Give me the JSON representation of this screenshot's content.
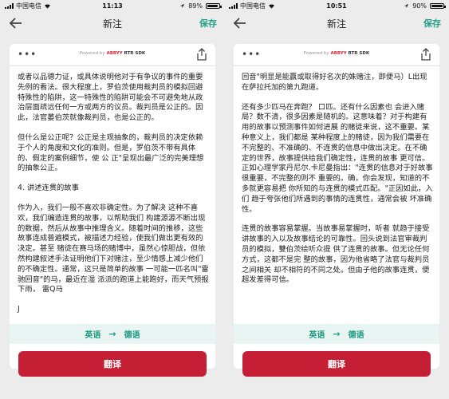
{
  "left": {
    "status": {
      "carrier": "中国电信",
      "time": "11:13",
      "battery_text": "89%",
      "battery_level": 0.89
    },
    "nav": {
      "title": "新注",
      "save": "保存"
    },
    "powered": {
      "prefix": "Powered by",
      "brand": "ABBYY",
      "suffix": "RTR SDK"
    },
    "text": {
      "p1": "或者以品德力证，或具体说明他对于有争议的事件的重要先例的看法。很大程度上，罗伯茨使用裁判员的模拟回避特殊性的陷阱，这一特殊性的陷阱可能会不可避免地从政治层面疏远任何一方或两方的议员。裁判员是公正的。因此，法官萎伯茨就像裁判员，也是公正的。",
      "p2": "但什么是公正呢？公正是主观抽象的，裁判员的决定依赖于个人的角度和文化的准则。但是，罗伯茨不带有具体的、假定的案例细节，使 公 正\"呈现出最广泛的完美理想的抽象公正。",
      "p3": "4. 讲述连贯的故事",
      "p4": "作为入，我们一般不喜欢非确定性。为了解决 这种不喜欢，我们编造连贯的故事，以帮助我们 构建源源不断出现的数据，然后从故事中推理含义。随着时间的推移，这些故事连成普遍模式，被描述力经验，使我们做出更有效的决定。甚至 赌徒在赛马场的赌博中，虽然心惊胆战，但依然构建叙述手法证明他们下对赌注，至少情感上减少他们的不确定性。通常，这只是简单的故事 一可能一匹名叫\"雷驰回音\"的马，最近在湿 派派的跑道上能跑好，而天气预报下雨， 雷Q马",
      "p5": "J"
    },
    "lang": {
      "from": "英语",
      "to": "德语"
    },
    "translate": "翻译"
  },
  "right": {
    "status": {
      "carrier": "中国电信",
      "time": "10:51",
      "battery_text": "90%",
      "battery_level": 0.9
    },
    "nav": {
      "title": "新注",
      "save": "保存"
    },
    "powered": {
      "prefix": "Powered by",
      "brand": "ABBYY",
      "suffix": "RTR SDK"
    },
    "text": {
      "p1": "回音\"明显是能赢或取得好名次的姝赌注，即便马）L出现在萨拉托加的第九跑道。",
      "p2": "还有多少匹马在奔跑？ 口匹。还有什么因素也 会进入赌局？数不清，很多因素是随机的。这意味着？对于构建有用的故事以预测事件如何进展 的赌徒来说，这不重要。某种意义上，我们都是 某种程度上的赌徒，因为我们需要在不完整的、不准确的、不连贯的信息中做出决定。在不确定的世界，故事提供给我们确定性，连贯的故事 更可信。正如心理学家丹尼尔.卡尼曼指出：\"连贯的信息对于好故事很重要，不完整的则不 重要的。确，你会发现，知道的不多就更容易把 你所知的与连贯的模式匹配。\"正因如此，入们 趋于夸张他们所遇到的事情的连贯性，通常会被 坏准确性。",
      "p3": "连贯的故事容易掌握。当故事易掌握时，听者 就趋于接受讲故事的入以及故事结论的可靠性。回头说到法官审裁判员的模拟，雙伯茨绘听众提 供了连贯的故事。但无论任何方式，这都不是完 整的故事，因为他省略了法官与裁判员之间相关 却不相符的不同之处。但由子他的故事连贯，便 超发差得可信。"
    },
    "lang": {
      "from": "英语",
      "to": "德语"
    },
    "translate": "翻译"
  },
  "icons": {
    "back": "back-arrow-icon",
    "more": "more-dots-icon",
    "share": "share-icon",
    "wifi": "wifi-icon",
    "signal": "signal-icon",
    "battery": "battery-icon",
    "lang_arrow": "arrow-right-icon"
  },
  "colors": {
    "accent": "#27a38a",
    "button_red": "#c51f35",
    "lang_bar_bg": "#e8f5f3",
    "brand_red": "#d8283b"
  }
}
